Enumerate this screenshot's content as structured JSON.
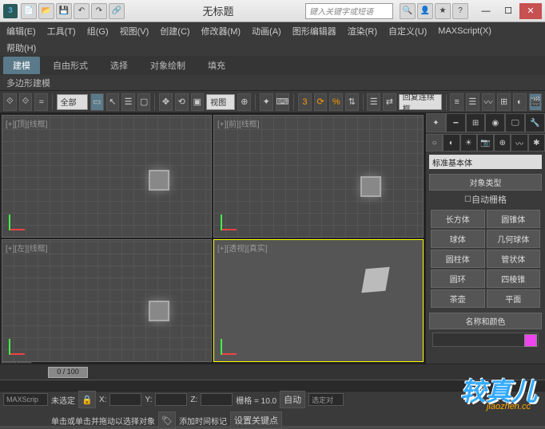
{
  "title": "无标题",
  "search_placeholder": "键入关键字或短语",
  "menu": [
    "编辑(E)",
    "工具(T)",
    "组(G)",
    "视图(V)",
    "创建(C)",
    "修改器(M)",
    "动画(A)",
    "图形编辑器",
    "渲染(R)",
    "自定义(U)",
    "MAXScript(X)"
  ],
  "menu2": "帮助(H)",
  "ribbon_tabs": [
    "建模",
    "自由形式",
    "选择",
    "对象绘制",
    "填充"
  ],
  "ribbon_sub": "多边形建模",
  "toolbar_sel1": "全部",
  "toolbar_sel2": "视图",
  "toolbar_sel3": "回复连续框",
  "viewports": [
    {
      "label": "[+][顶][线框]"
    },
    {
      "label": "[+][前][线框]"
    },
    {
      "label": "[+][左][线框]"
    },
    {
      "label": "[+][透视][真实]"
    }
  ],
  "cmdpanel": {
    "dropdown": "标准基本体",
    "section1": "对象类型",
    "autogrid": "自动栅格",
    "buttons": [
      "长方体",
      "圆锥体",
      "球体",
      "几何球体",
      "圆柱体",
      "管状体",
      "圆环",
      "四棱锥",
      "茶壶",
      "平面"
    ],
    "section2": "名称和颜色"
  },
  "timeline": {
    "pos": "0 / 100"
  },
  "status": {
    "unselected": "未选定",
    "xyz_x": "X:",
    "xyz_y": "Y:",
    "xyz_z": "Z:",
    "grid": "栅格 = 10.0",
    "auto": "自动",
    "filter": "选定对",
    "hint": "单击或单击并拖动以选择对象",
    "addtime": "添加时间标记",
    "setkey": "设置关键点",
    "script": "MAXScrip"
  },
  "watermark": "较真儿",
  "watermark_sub": "jiaozhen.cc"
}
